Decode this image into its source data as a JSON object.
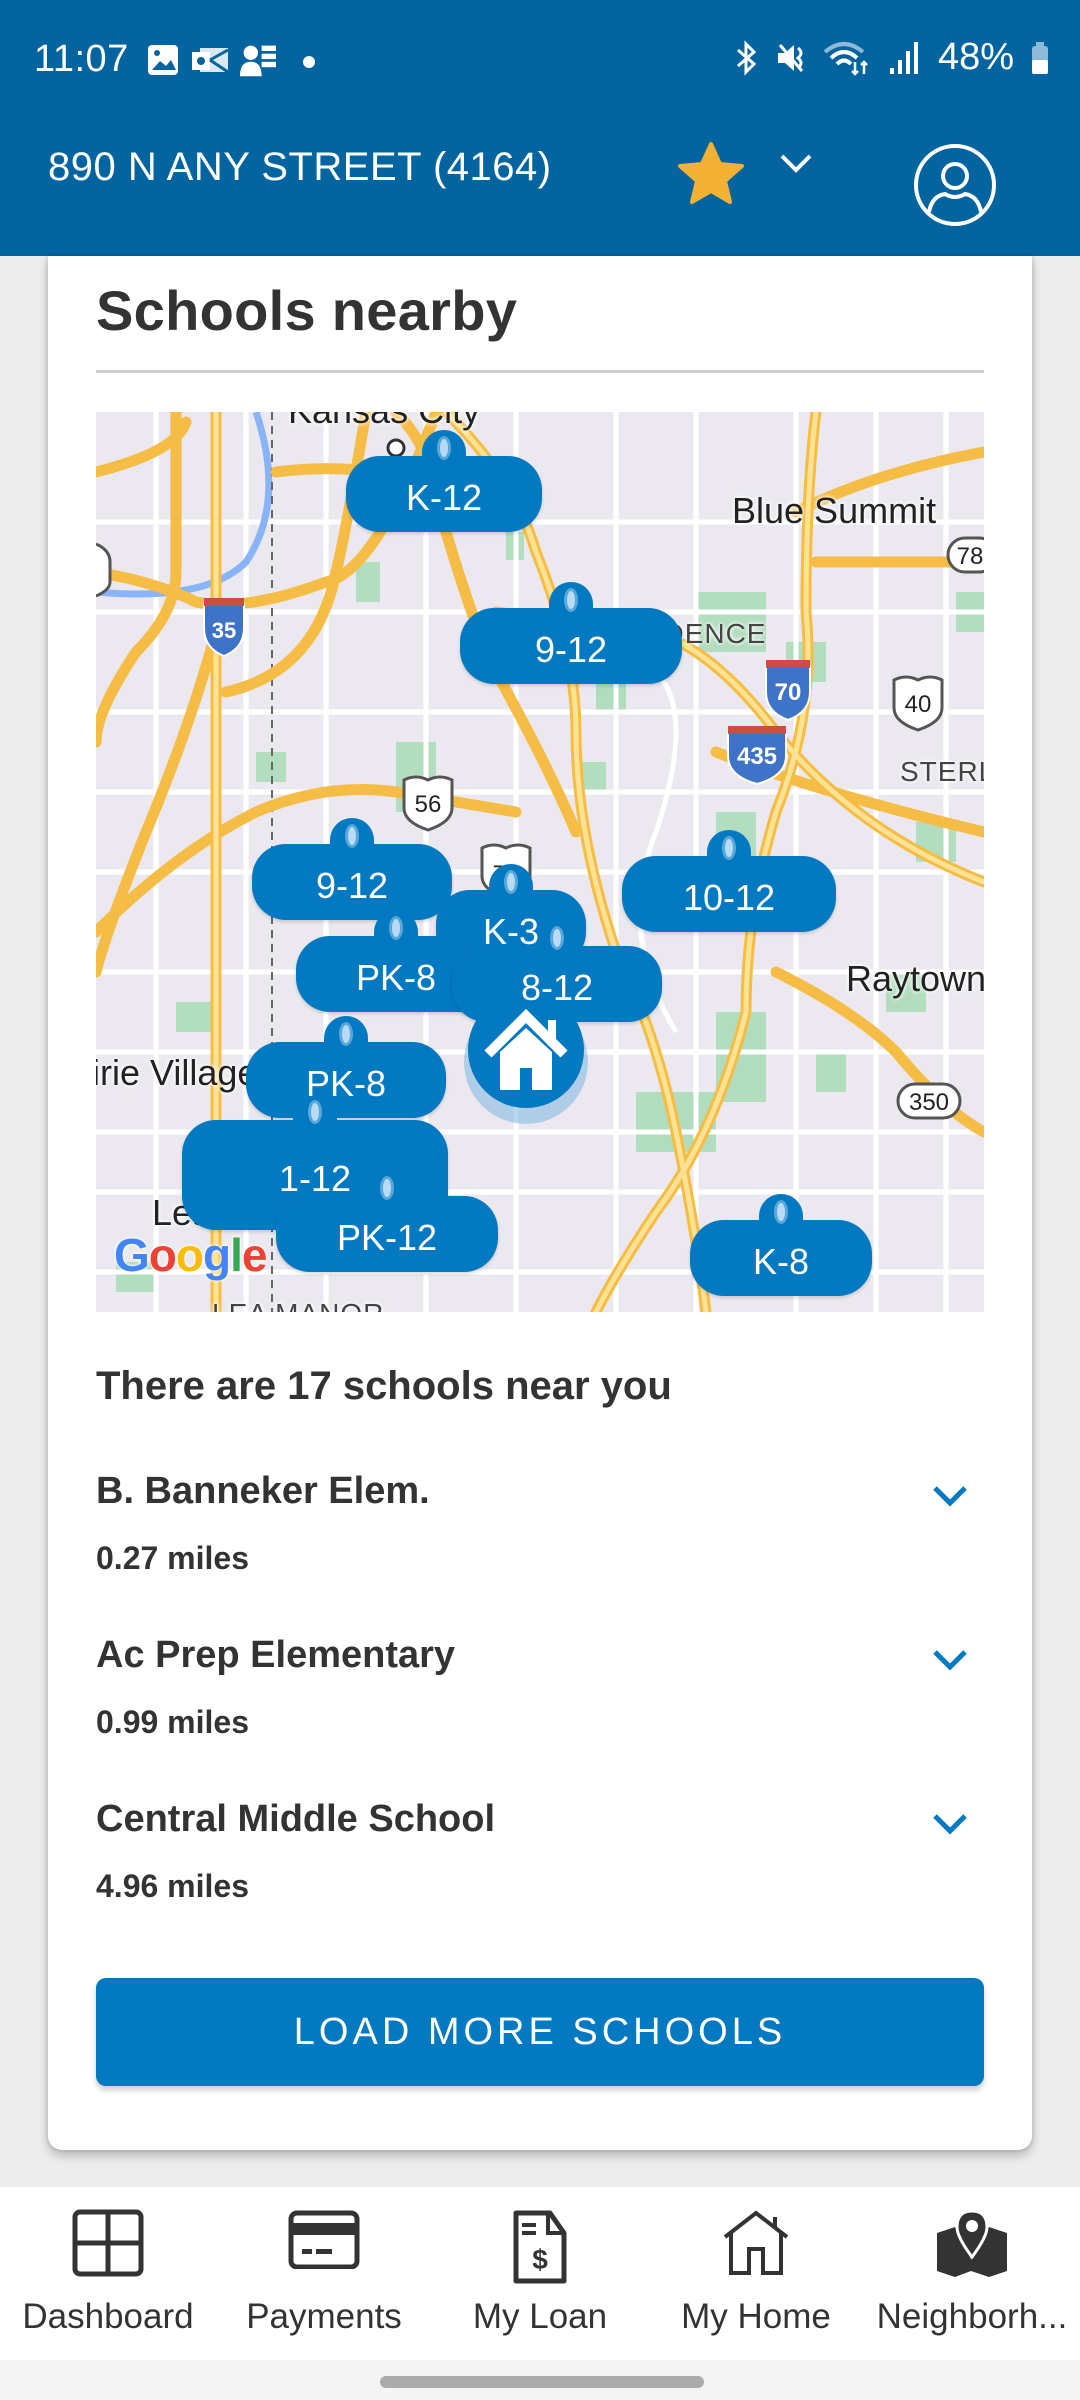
{
  "status_bar": {
    "time": "11:07",
    "battery": "48%",
    "notification_icons": [
      "gallery-icon",
      "outlook-icon",
      "teams-icon",
      "dot-icon"
    ],
    "system_icons": [
      "bluetooth-icon",
      "mute-icon",
      "wifi-icon",
      "signal-icon",
      "battery-icon"
    ]
  },
  "header": {
    "title": "890 N ANY STREET (4164)",
    "favorite": true,
    "colors": {
      "bar": "#03649f",
      "star": "#f3b234"
    }
  },
  "card": {
    "title": "Schools nearby",
    "map": {
      "places": [
        "Kansas City",
        "Blue Summit",
        "Raytown",
        "Leawood",
        "Prairie Village",
        "STERLING",
        "INDEPENDENCE",
        "LEA MANOR"
      ],
      "route_shields": [
        "35",
        "70",
        "435",
        "40",
        "56",
        "71",
        "78",
        "350"
      ],
      "attribution": "Google",
      "pins": [
        {
          "grade": "K-12"
        },
        {
          "grade": "9-12"
        },
        {
          "grade": "9-12"
        },
        {
          "grade": "K-3"
        },
        {
          "grade": "10-12"
        },
        {
          "grade": "PK-8"
        },
        {
          "grade": "8-12"
        },
        {
          "grade": "PK-8"
        },
        {
          "grade": "1-12"
        },
        {
          "grade": "PK-12"
        },
        {
          "grade": "K-8"
        }
      ]
    },
    "count_text": "There are 17 schools near you",
    "schools": [
      {
        "name": "B. Banneker Elem.",
        "distance": "0.27 miles"
      },
      {
        "name": "Ac Prep Elementary",
        "distance": "0.99 miles"
      },
      {
        "name": "Central Middle School",
        "distance": "4.96 miles"
      }
    ],
    "load_more_label": "LOAD MORE SCHOOLS",
    "accent_color": "#0379c2"
  },
  "bottom_nav": {
    "items": [
      {
        "label": "Dashboard",
        "icon": "dashboard-icon"
      },
      {
        "label": "Payments",
        "icon": "credit-card-icon"
      },
      {
        "label": "My Loan",
        "icon": "loan-document-icon"
      },
      {
        "label": "My Home",
        "icon": "home-icon"
      },
      {
        "label": "Neighborh...",
        "icon": "map-pin-icon"
      }
    ]
  }
}
